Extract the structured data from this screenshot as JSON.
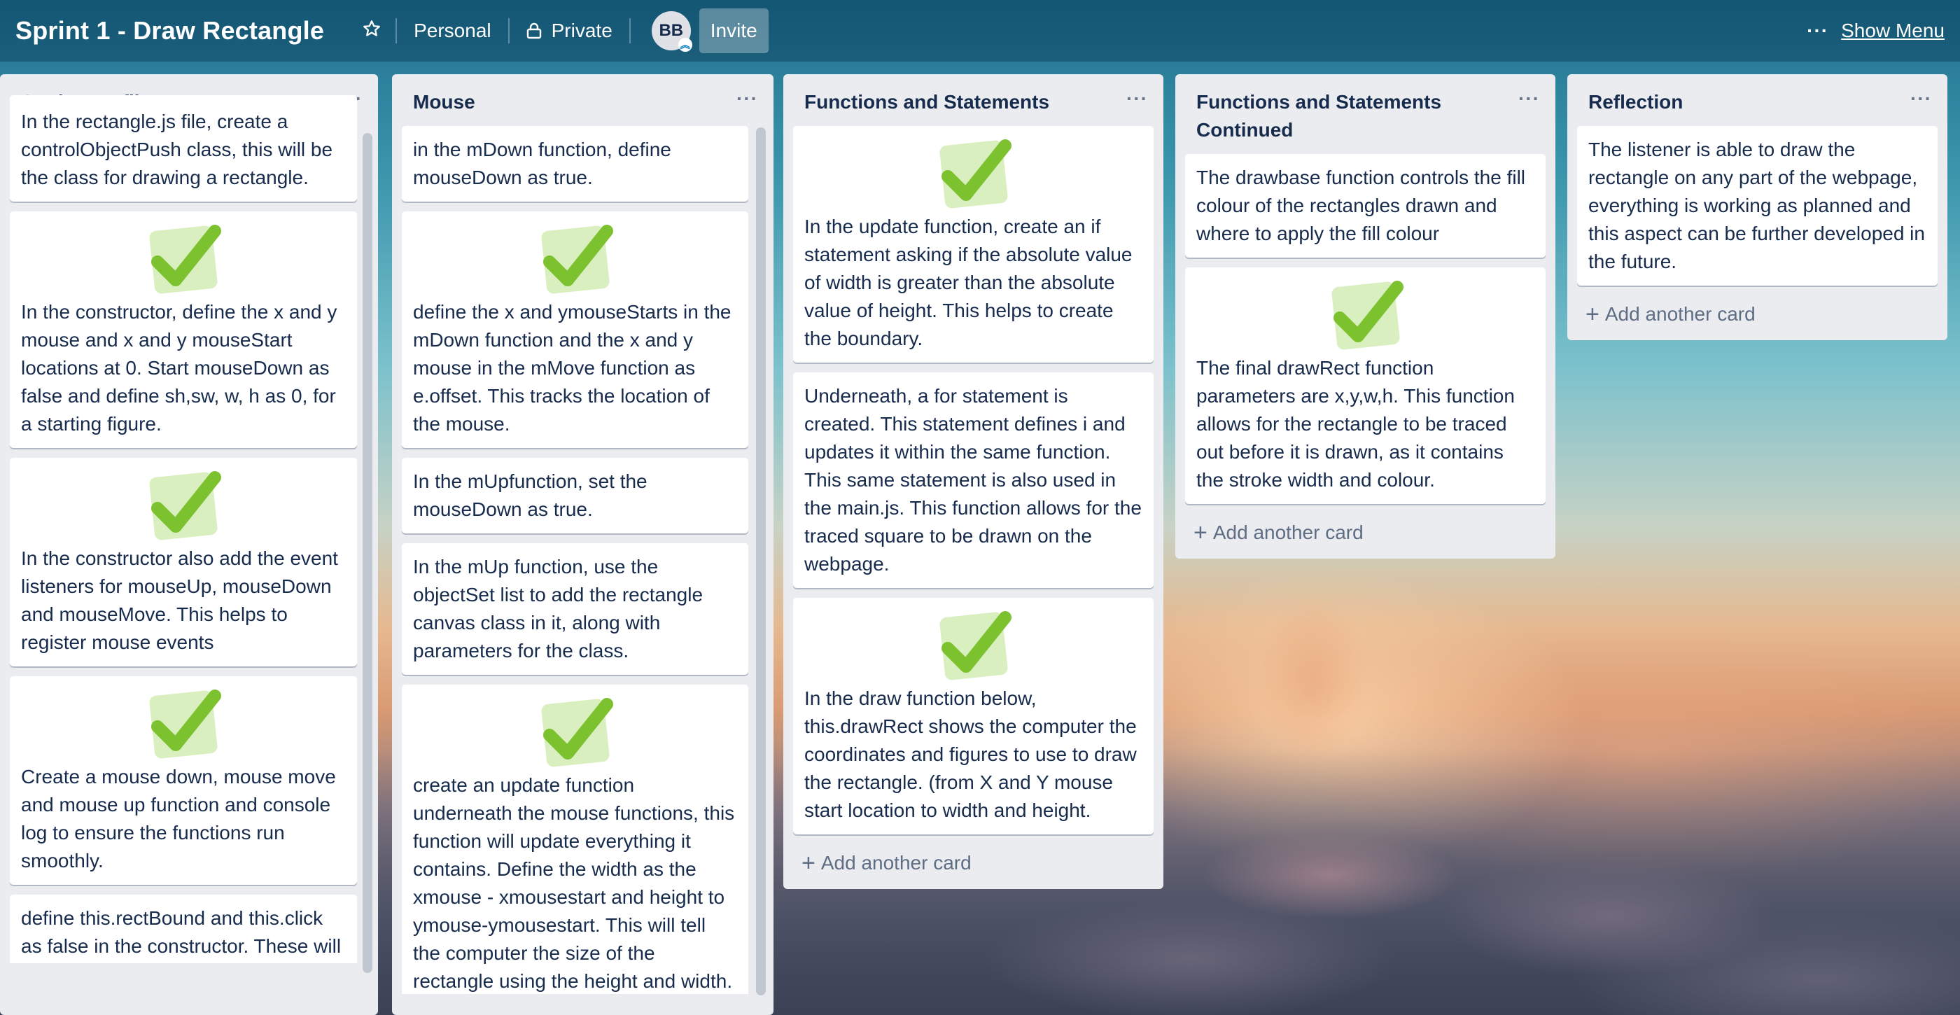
{
  "header": {
    "board_title": "Sprint 1 - Draw Rectangle",
    "team_label": "Personal",
    "visibility_label": "Private",
    "avatar_initials": "BB",
    "invite_label": "Invite",
    "more_label": "···",
    "show_menu_label": "Show Menu"
  },
  "lists": [
    {
      "title": "Setting up files",
      "menu_label": "···",
      "cards": [
        {
          "text": "In the rectangle.js file, create a controlObjectPush class, this will be the class for drawing a rectangle.",
          "check": false
        },
        {
          "text": "In the constructor, define the x and y mouse and x and y mouseStart locations at 0. Start mouseDown as false and define sh,sw, w, h as 0, for a starting figure.",
          "check": true
        },
        {
          "text": "In the constructor also add the event listeners for mouseUp, mouseDown and mouseMove. This helps to register mouse events",
          "check": true
        },
        {
          "text": "Create a mouse down, mouse move and mouse up function and console log to ensure the functions run smoothly.",
          "check": true
        },
        {
          "text": "define this.rectBound and this.click as false in the constructor. These will be used in future statements.",
          "check": false
        }
      ]
    },
    {
      "title": "Mouse",
      "menu_label": "···",
      "cards": [
        {
          "text": "in the mDown function, define mouseDown as true.",
          "check": false
        },
        {
          "text": "define the x and ymouseStarts in the mDown function and the x and y mouse in the mMove function as e.offset. This tracks the location of the mouse.",
          "check": true
        },
        {
          "text": "In the mUpfunction, set the mouseDown as true.",
          "check": false
        },
        {
          "text": "In the mUp function, use the objectSet list to add the rectangle canvas class in it, along with parameters for the class.",
          "check": false
        },
        {
          "text": "create an update function underneath the mouse functions, this function will update everything it contains. Define the width as the xmouse - xmousestart and height to ymouse-ymousestart. This will tell the computer the size of the rectangle using the height and width.",
          "check": true
        }
      ]
    },
    {
      "title": "Functions and Statements",
      "menu_label": "···",
      "add_label": "Add another card",
      "cards": [
        {
          "text": "In the update function, create an if statement asking if the absolute value of width is greater than the absolute value of height. This helps to create the boundary.",
          "check": true
        },
        {
          "text": "Underneath, a for statement is created. This statement defines i and updates it within the same function. This same statement is also used in the main.js. This function allows for the traced square to be drawn on the webpage.",
          "check": false
        },
        {
          "text": "In the draw function below, this.drawRect shows the computer the coordinates and figures to use to draw the rectangle. (from X and Y mouse start location to width and height.",
          "check": true
        }
      ]
    },
    {
      "title": "Functions and Statements Continued",
      "menu_label": "···",
      "add_label": "Add another card",
      "cards": [
        {
          "text": "The drawbase function controls the fill colour of the rectangles drawn and where to apply the fill colour",
          "check": false
        },
        {
          "text": "The final drawRect function parameters are x,y,w,h. This function allows for the rectangle to be traced out before it is drawn, as it contains the stroke width and colour.",
          "check": true
        }
      ]
    },
    {
      "title": "Reflection",
      "menu_label": "···",
      "add_label": "Add another card",
      "cards": [
        {
          "text": "The listener is able to draw the rectangle on any part of the webpage, everything is working as planned and this aspect can be further developed in the future.",
          "check": false
        }
      ]
    }
  ],
  "colors": {
    "list_bg": "#ebecf0",
    "check_green": "#7cc12e",
    "check_tile": "#d9efc0"
  }
}
